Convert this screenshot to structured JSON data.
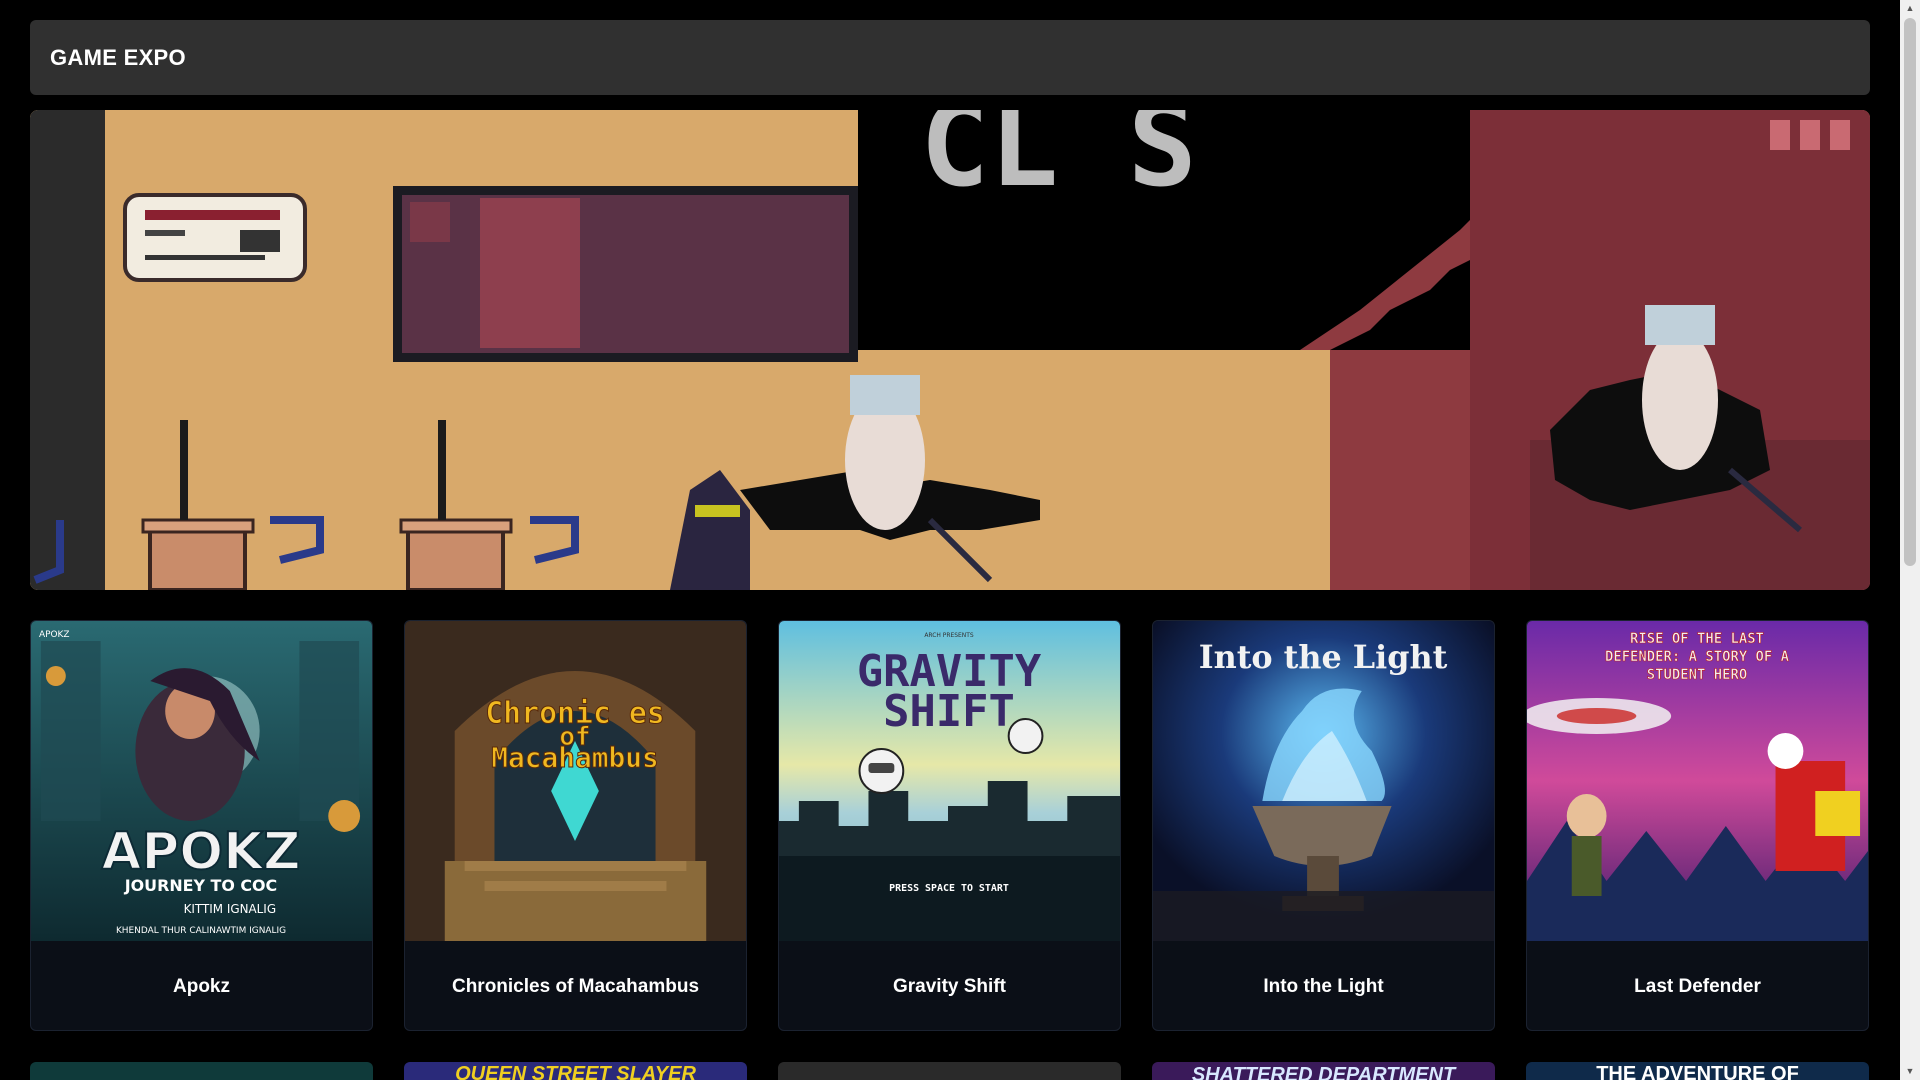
{
  "header": {
    "title": "GAME EXPO"
  },
  "hero": {
    "title_text": "CL  S"
  },
  "games": [
    {
      "title": "Apokz",
      "cover_title": "APOKZ",
      "cover_subtitle": "JOURNEY TO COC",
      "cover_author": "KITTIM IGNALIG",
      "cover_credits": "KHENDAL THUR CALINAWTIM IGNALIG",
      "cover_tag": "APOKZ"
    },
    {
      "title": "Chronicles of Macahambus",
      "cover_line1": "Chronic  es",
      "cover_line2": "of",
      "cover_line3": "Macahambus"
    },
    {
      "title": "Gravity Shift",
      "cover_presents": "ARCH PRESENTS",
      "cover_line1": "GRAVITY",
      "cover_line2": "SHIFT",
      "cover_prompt": "PRESS SPACE TO START"
    },
    {
      "title": "Into the Light",
      "cover_title": "Into the Light"
    },
    {
      "title": "Last Defender",
      "cover_title": "RISE OF THE LAST DEFENDER: A STORY OF A STUDENT HERO"
    }
  ],
  "row2": [
    {
      "cover_text": ""
    },
    {
      "cover_text": "QUEEN STREET SLAYER"
    },
    {
      "cover_text": ""
    },
    {
      "cover_text": "SHATTERED DEPARTMENT"
    },
    {
      "cover_text": "THE ADVENTURE OF"
    }
  ],
  "colors": {
    "background": "#000000",
    "header_bg": "#303030",
    "card_bg": "#0b0f17"
  }
}
